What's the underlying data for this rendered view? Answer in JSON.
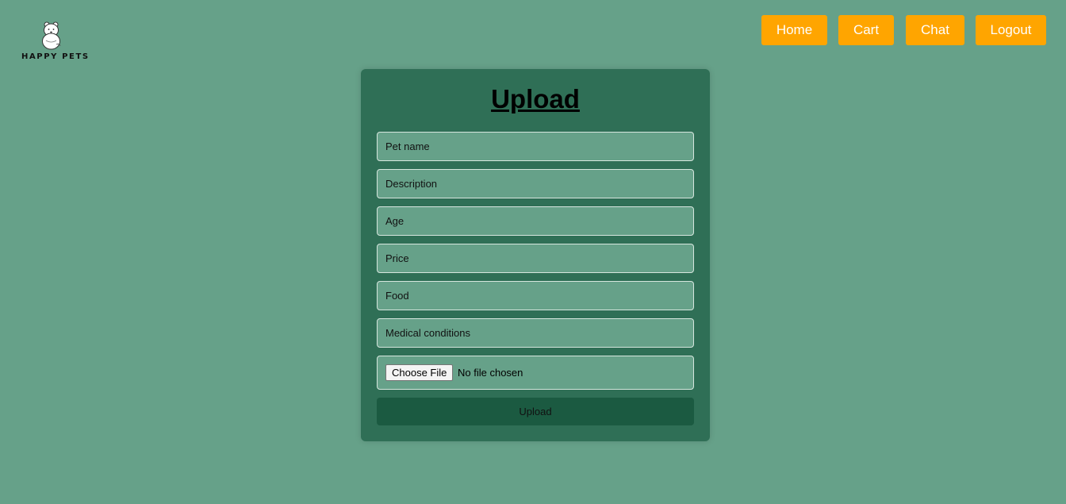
{
  "brand": {
    "logo_icon": "bear-icon",
    "name": "HAPPY PETS"
  },
  "nav": {
    "home": "Home",
    "cart": "Cart",
    "chat": "Chat",
    "logout": "Logout"
  },
  "form": {
    "title": "Upload",
    "fields": {
      "pet_name": {
        "value": "",
        "placeholder": "Pet name"
      },
      "description": {
        "value": "",
        "placeholder": "Description"
      },
      "age": {
        "value": "",
        "placeholder": "Age"
      },
      "price": {
        "value": "",
        "placeholder": "Price"
      },
      "food": {
        "value": "",
        "placeholder": "Food"
      },
      "medical": {
        "value": "",
        "placeholder": "Medical conditions"
      }
    },
    "file": {
      "button_label": "Choose File",
      "status": "No file chosen"
    },
    "submit_label": "Upload"
  },
  "colors": {
    "background": "#66a189",
    "card": "#2f6f56",
    "nav_button": "#ffa500",
    "submit_button": "#1b5a41"
  }
}
